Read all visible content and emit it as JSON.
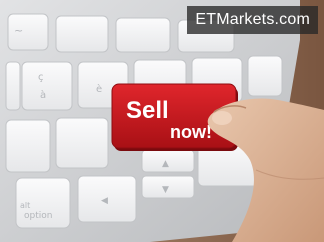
{
  "watermark": {
    "text": "ETMarkets.com"
  },
  "keyboard": {
    "sell_key": {
      "line1": "Sell",
      "line2": "now!"
    },
    "keys": {
      "option": "option",
      "alt": "alt",
      "tilde": "~",
      "c_cedilla": "ç",
      "a_grave": "à",
      "e_grave": "è",
      "arrow_up": "▲",
      "arrow_down": "▼",
      "arrow_left": "◀"
    }
  },
  "colors": {
    "sell_key": "#c4161c",
    "keyboard_body": "#c9cbce",
    "key_face": "#f4f4f5",
    "desk": "#8e6a52",
    "watermark_bg": "#282828"
  }
}
